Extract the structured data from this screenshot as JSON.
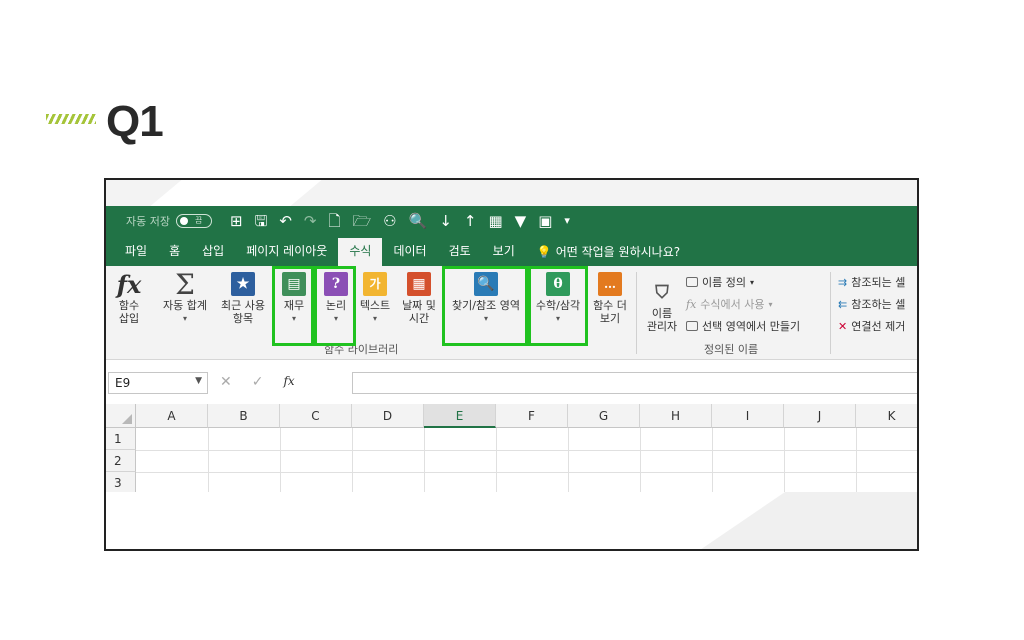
{
  "slide": {
    "title": "Q1"
  },
  "titlebar": {
    "autosave_label": "자동 저장",
    "autosave_state": "끔"
  },
  "tabs": [
    "파일",
    "홈",
    "삽입",
    "페이지 레이아웃",
    "수식",
    "데이터",
    "검토",
    "보기"
  ],
  "active_tab": "수식",
  "tell_me": "어떤 작업을 원하시나요?",
  "ribbon": {
    "insert_function": [
      "함수",
      "삽입"
    ],
    "autosum": "자동 합계",
    "recent": [
      "최근 사용",
      "항목"
    ],
    "financial": "재무",
    "logical": "논리",
    "text": "텍스트",
    "datetime": [
      "날짜 및",
      "시간"
    ],
    "lookup": "찾기/참조 영역",
    "math": "수학/삼각",
    "more": [
      "함수 더",
      "보기"
    ],
    "function_library_label": "함수 라이브러리",
    "name_manager": [
      "이름",
      "관리자"
    ],
    "define_name": "이름 정의",
    "use_in_formula": "수식에서 사용",
    "create_from_selection": "선택 영역에서 만들기",
    "defined_names_label": "정의된 이름",
    "trace_precedents": "참조되는 셀",
    "trace_dependents": "참조하는 셀",
    "remove_arrows": "연결선 제거"
  },
  "icons": {
    "financial_color": "#3f8f5a",
    "logical_color": "#8b4fb5",
    "text_color": "#f2b531",
    "datetime_color": "#d4502c",
    "lookup_color": "#2a7bb6",
    "math_color": "#2f9a5b",
    "more_color": "#e37a1f",
    "autosum_icon": "sigma-icon",
    "recent_icon": "star-book-icon"
  },
  "highlight_color": "#1fc21f",
  "formula_bar": {
    "name_box": "E9",
    "fx": "fx"
  },
  "grid": {
    "columns": [
      "A",
      "B",
      "C",
      "D",
      "E",
      "F",
      "G",
      "H",
      "I",
      "J",
      "K"
    ],
    "selected_column": "E",
    "rows": [
      "1",
      "2",
      "3"
    ]
  }
}
